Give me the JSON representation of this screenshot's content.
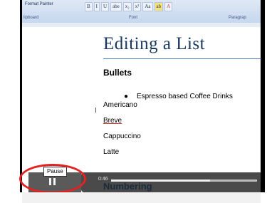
{
  "ribbon": {
    "format_painter": "Format Painter",
    "clipboard_label": "lipboard",
    "font_label": "Font",
    "paragraph_label": "Paragrap",
    "buttons": [
      "B",
      "I",
      "U",
      "abe",
      "x₂",
      "x²",
      "Aa",
      "ab",
      "A"
    ],
    "highlight_colors": {
      "highlight": "#f6e27a",
      "font_color": "#d63333"
    }
  },
  "slide": {
    "title": "Editing a List",
    "bullets_heading": "Bullets",
    "bullet_item": "Espresso based Coffee Drinks",
    "items": [
      "Americano",
      "Breve",
      "Cappuccino",
      "Latte"
    ],
    "numbering_heading": "Numbering"
  },
  "player": {
    "pause_tooltip": "Pause",
    "time": "0:46",
    "progress": 0.68
  },
  "colors": {
    "title": "#17375e",
    "annotation_circle": "#e32121"
  }
}
